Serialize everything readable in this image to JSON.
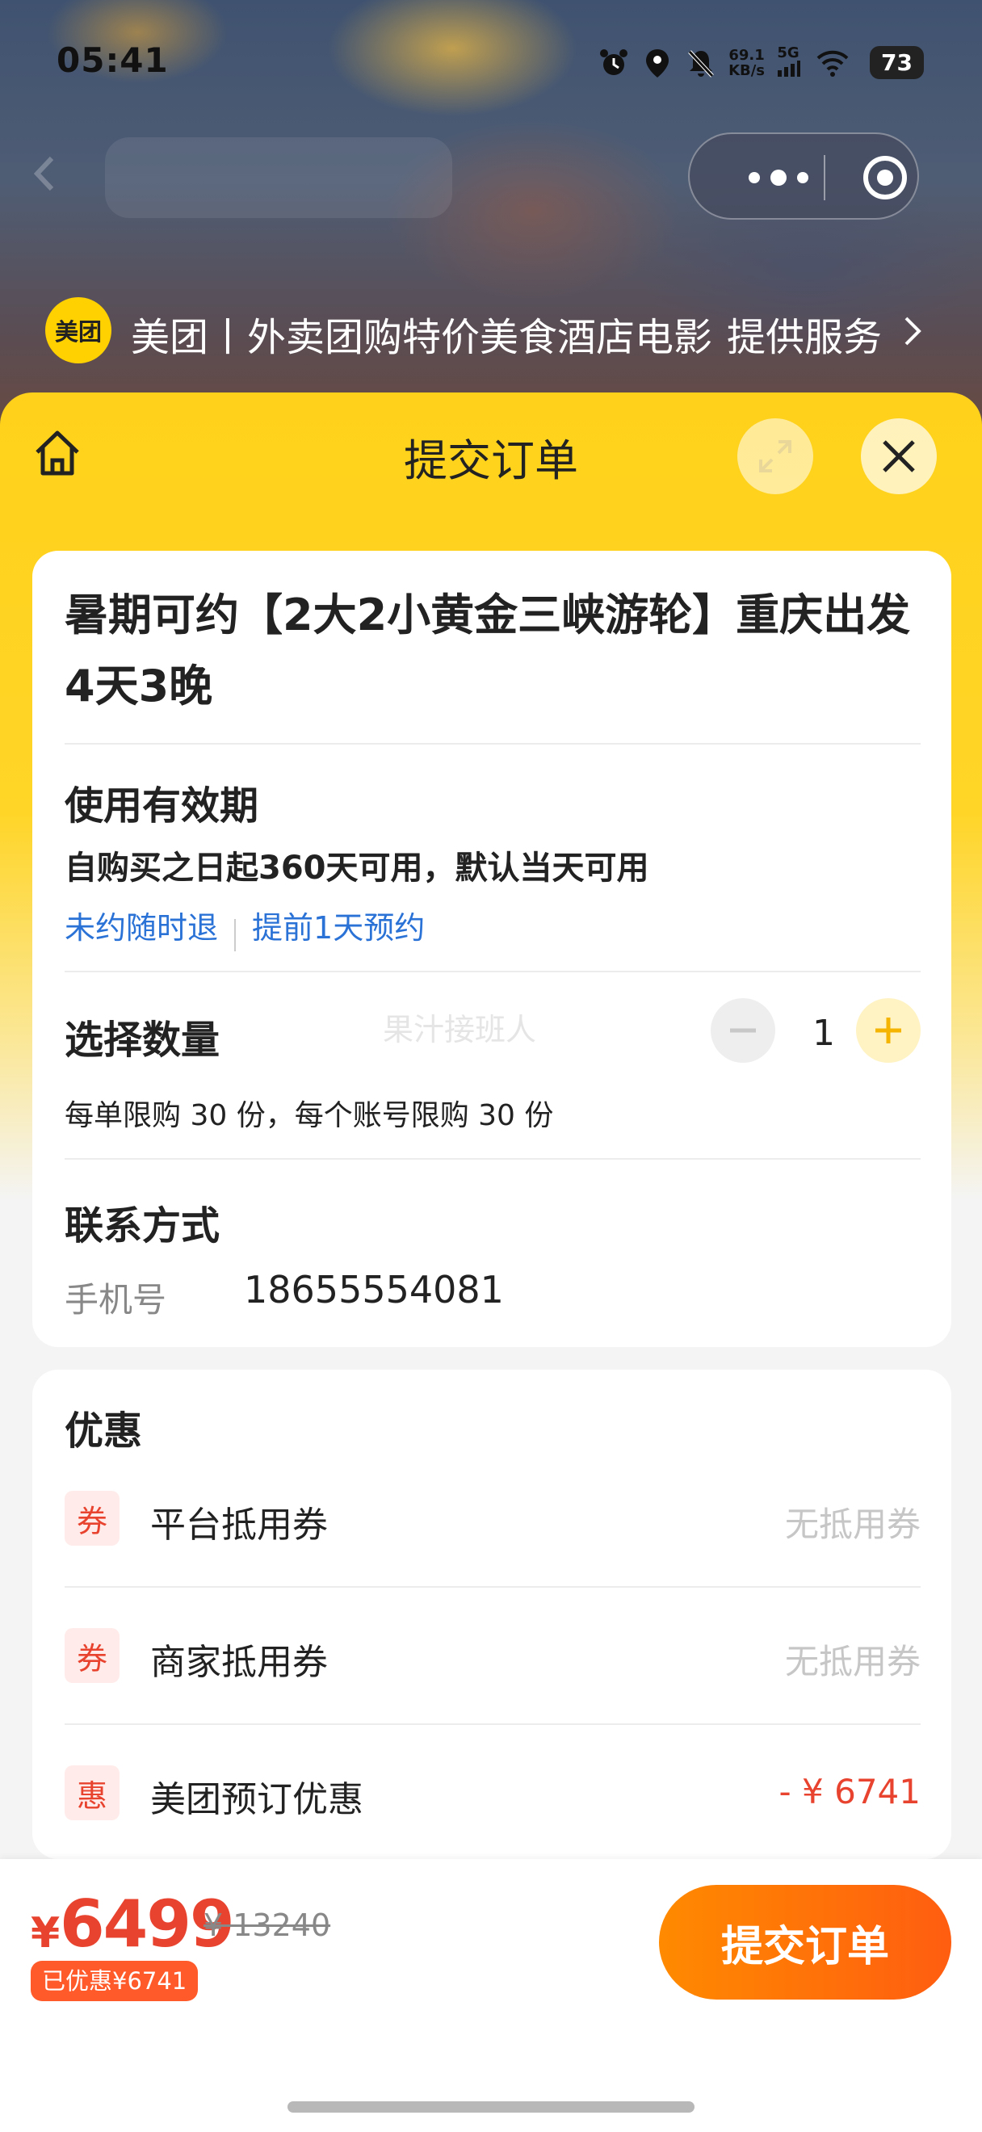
{
  "status_bar": {
    "time": "05:41",
    "net_speed_value": "69.1",
    "net_speed_unit": "KB/s",
    "network_type": "5G",
    "battery": "73"
  },
  "mini_program": {
    "logo_text": "美团",
    "title": "美团丨外卖团购特价美食酒店电影",
    "service_label": "提供服务"
  },
  "sheet": {
    "title": "提交订单"
  },
  "product": {
    "title": "暑期可约【2大2小黄金三峡游轮】重庆出发4天3晚"
  },
  "validity": {
    "heading": "使用有效期",
    "text": "自购买之日起360天可用，默认当天可用",
    "link_refund": "未约随时退",
    "link_reserve": "提前1天预约"
  },
  "quantity": {
    "heading": "选择数量",
    "watermark": "果汁接班人",
    "value": "1",
    "limit_note": "每单限购 30 份，每个账号限购 30 份"
  },
  "contact": {
    "heading": "联系方式",
    "phone_label": "手机号",
    "phone_value": "18655554081"
  },
  "discounts": {
    "heading": "优惠",
    "items": [
      {
        "tag": "券",
        "name": "平台抵用券",
        "value": "无抵用券"
      },
      {
        "tag": "券",
        "name": "商家抵用券",
        "value": "无抵用券"
      },
      {
        "tag": "惠",
        "name": "美团预订优惠",
        "value": "- ¥ 6741"
      }
    ]
  },
  "checkout": {
    "currency": "¥",
    "price": "6499",
    "original_price": "¥ 13240",
    "saved_badge": "已优惠¥6741",
    "submit_label": "提交订单"
  },
  "colors": {
    "brand_yellow": "#ffd100",
    "accent_red": "#e8432f",
    "submit_orange": "#ff6a10",
    "link_blue": "#2a72d6"
  }
}
